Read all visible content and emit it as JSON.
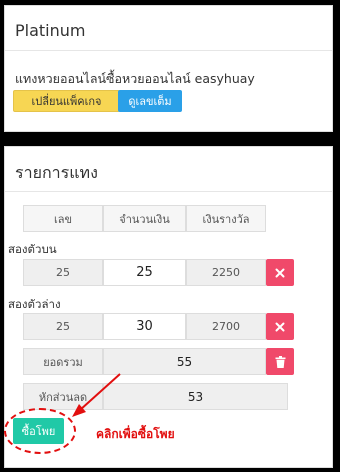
{
  "package": {
    "title": "Platinum",
    "description": "แทงหวยออนไลน์ซื้อหวยออนไลน์ easyhuay",
    "change_button": "เปลี่ยนแพ็คเกจ",
    "view_button": "ดูเลขเต็ม"
  },
  "bets": {
    "title": "รายการแทง",
    "headers": [
      "เลข",
      "จำนวนเงิน",
      "เงินรางวัล"
    ],
    "rows": [
      {
        "label": "สองตัวบน",
        "number": "25",
        "amount": "25",
        "reward": "2250"
      },
      {
        "label": "สองตัวล่าง",
        "number": "25",
        "amount": "30",
        "reward": "2700"
      }
    ],
    "total_label": "ยอดรวม",
    "total_value": "55",
    "discount_label": "หักส่วนลด",
    "discount_value": "53",
    "buy_button": "ซื้อโพย",
    "annotation": "คลิกเพื่อซื้อโพย"
  },
  "colors": {
    "accent_yellow": "#f7d653",
    "accent_blue": "#2aa0e8",
    "danger": "#f0496a",
    "success": "#20c9a7",
    "annotation": "#e20f0f"
  },
  "icons": {
    "delete": "close-icon",
    "trash": "trash-icon"
  }
}
